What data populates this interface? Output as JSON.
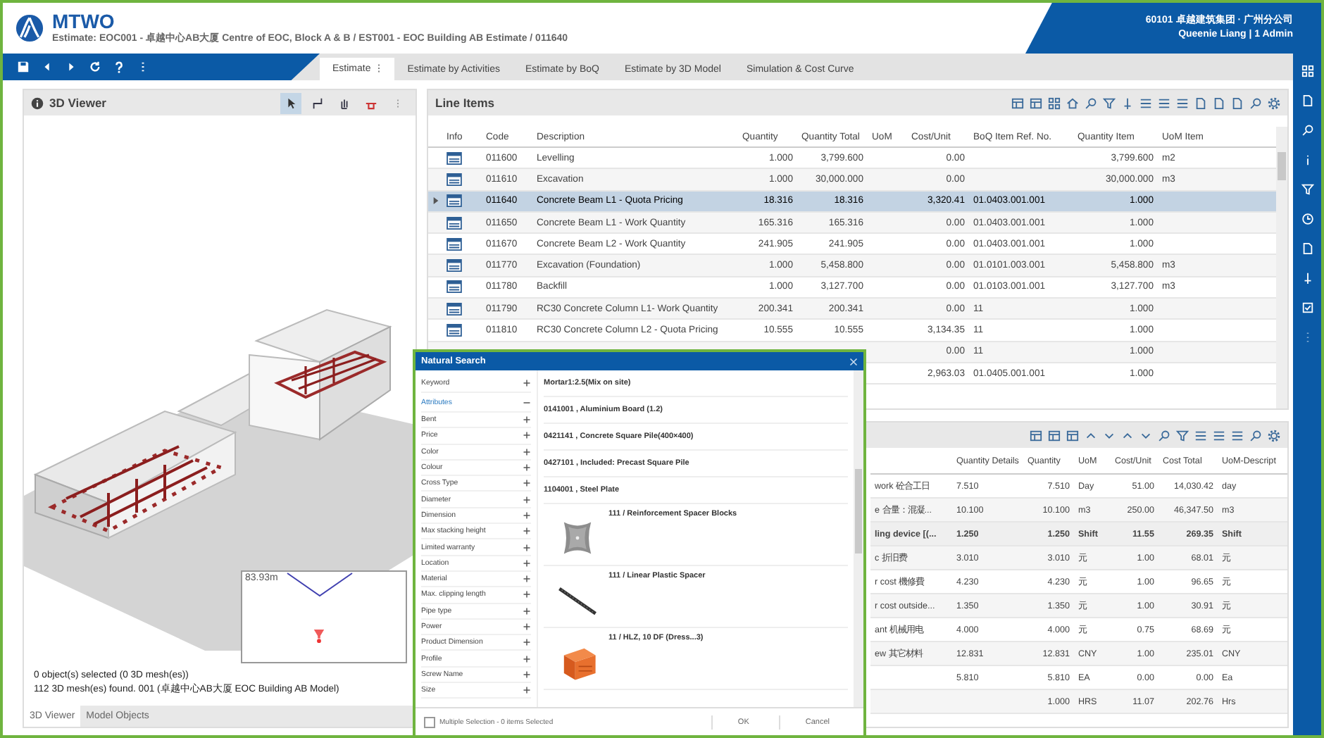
{
  "app": {
    "logo": "MTWO",
    "breadcrumb": "Estimate: EOC001 - 卓越中心AB大厦 Centre of EOC, Block A & B / EST001 - EOC Building AB Estimate / 011640",
    "company": "60101 卓越建筑集团 · 广州分公司",
    "user": "Queenie Liang | 1 Admin"
  },
  "tabs": [
    {
      "label": "Estimate",
      "selected": true
    },
    {
      "label": "Estimate by Activities",
      "selected": false
    },
    {
      "label": "Estimate by BoQ",
      "selected": false
    },
    {
      "label": "Estimate by 3D Model",
      "selected": false
    },
    {
      "label": "Simulation & Cost Curve",
      "selected": false
    }
  ],
  "viewer": {
    "title": "3D Viewer",
    "scale_label": "83.93m",
    "status": [
      "0 object(s) selected (0 3D mesh(es))",
      "112 3D mesh(es) found.   001 (卓越中心AB大厦 EOC Building AB Model)"
    ],
    "tabs": [
      {
        "label": "3D Viewer",
        "selected": true
      },
      {
        "label": "Model Objects",
        "selected": false
      }
    ]
  },
  "line_items": {
    "title": "Line Items",
    "columns": [
      "Info",
      "Code",
      "Description",
      "Quantity",
      "Quantity Total",
      "UoM",
      "Cost/Unit",
      "BoQ Item Ref. No.",
      "Quantity Item",
      "UoM Item"
    ],
    "rows": [
      {
        "selected": false,
        "cells": [
          "",
          "011600",
          "Levelling",
          "1.000",
          "3,799.600",
          null,
          "0.00",
          null,
          "3,799.600",
          "m2"
        ]
      },
      {
        "selected": false,
        "cells": [
          "",
          "011610",
          "Excavation",
          "1.000",
          "30,000.000",
          null,
          "0.00",
          null,
          "30,000.000",
          "m3"
        ]
      },
      {
        "selected": true,
        "cells": [
          "",
          "011640",
          "Concrete Beam L1 - Quota Pricing",
          "18.316",
          "18.316",
          null,
          "3,320.41",
          "01.0403.001.001",
          "1.000",
          null
        ]
      },
      {
        "selected": false,
        "cells": [
          "",
          "011650",
          "Concrete Beam L1 - Work Quantity",
          "165.316",
          "165.316",
          null,
          "0.00",
          "01.0403.001.001",
          "1.000",
          null
        ]
      },
      {
        "selected": false,
        "cells": [
          "",
          "011670",
          "Concrete Beam L2 - Work Quantity",
          "241.905",
          "241.905",
          null,
          "0.00",
          "01.0403.001.001",
          "1.000",
          null
        ]
      },
      {
        "selected": false,
        "cells": [
          "",
          "011770",
          "Excavation (Foundation)",
          "1.000",
          "5,458.800",
          null,
          "0.00",
          "01.0101.003.001",
          "5,458.800",
          "m3"
        ]
      },
      {
        "selected": false,
        "cells": [
          "",
          "011780",
          "Backfill",
          "1.000",
          "3,127.700",
          null,
          "0.00",
          "01.0103.001.001",
          "3,127.700",
          "m3"
        ]
      },
      {
        "selected": false,
        "cells": [
          "",
          "011790",
          "RC30 Concrete Column L1- Work Quantity",
          "200.341",
          "200.341",
          null,
          "0.00",
          "11",
          "1.000",
          null
        ]
      },
      {
        "selected": false,
        "cells": [
          "",
          "011810",
          "RC30 Concrete Column L2 - Quota Pricing",
          "10.555",
          "10.555",
          null,
          "3,134.35",
          "11",
          "1.000",
          null
        ]
      },
      {
        "selected": false,
        "cells": [
          null,
          null,
          null,
          null,
          null,
          null,
          "0.00",
          "11",
          "1.000",
          null
        ]
      },
      {
        "selected": false,
        "cells": [
          null,
          null,
          null,
          null,
          null,
          null,
          "2,963.03",
          "01.0405.001.001",
          "1.000",
          null
        ]
      }
    ]
  },
  "detail_table": {
    "columns": [
      null,
      "Quantity Details",
      "Quantity",
      "UoM",
      "Cost/Unit",
      "Cost Total",
      "UoM-Descript"
    ],
    "rows": [
      {
        "selected": false,
        "cells": [
          "work 砼合工日",
          "7.510",
          "7.510",
          "Day",
          "51.00",
          "14,030.42",
          "day"
        ]
      },
      {
        "selected": false,
        "cells": [
          "e 合量：混凝...",
          "10.100",
          "10.100",
          "m3",
          "250.00",
          "46,347.50",
          "m3"
        ]
      },
      {
        "selected": true,
        "cells": [
          "ling device [(...",
          "1.250",
          "1.250",
          "Shift",
          "11.55",
          "269.35",
          "Shift"
        ]
      },
      {
        "selected": false,
        "cells": [
          "c 折旧费",
          "3.010",
          "3.010",
          "元",
          "1.00",
          "68.01",
          "元"
        ]
      },
      {
        "selected": false,
        "cells": [
          "r cost 機修費",
          "4.230",
          "4.230",
          "元",
          "1.00",
          "96.65",
          "元"
        ]
      },
      {
        "selected": false,
        "cells": [
          "r cost outside...",
          "1.350",
          "1.350",
          "元",
          "1.00",
          "30.91",
          "元"
        ]
      },
      {
        "selected": false,
        "cells": [
          "ant 机械用电",
          "4.000",
          "4.000",
          "元",
          "0.75",
          "68.69",
          "元"
        ]
      },
      {
        "selected": false,
        "cells": [
          "ew 其它材料",
          "12.831",
          "12.831",
          "CNY",
          "1.00",
          "235.01",
          "CNY"
        ]
      },
      {
        "selected": false,
        "cells": [
          null,
          "5.810",
          "5.810",
          "EA",
          "0.00",
          "0.00",
          "Ea"
        ]
      },
      {
        "selected": false,
        "cells": [
          null,
          null,
          "1.000",
          "HRS",
          "11.07",
          "202.76",
          "Hrs"
        ]
      }
    ]
  },
  "natural_search": {
    "title": "Natural Search",
    "groups": [
      {
        "label": "Keyword",
        "expanded": false
      },
      {
        "label": "Attributes",
        "expanded": true,
        "children": [
          {
            "label": "Bent",
            "expanded": false
          },
          {
            "label": "Price",
            "expanded": false
          },
          {
            "label": "Color",
            "expanded": false
          },
          {
            "label": "Colour",
            "expanded": false
          },
          {
            "label": "Cross Type",
            "expanded": false
          },
          {
            "label": "Diameter",
            "expanded": false
          },
          {
            "label": "Dimension",
            "expanded": false
          },
          {
            "label": "Max stacking height",
            "expanded": false
          },
          {
            "label": "Limited warranty",
            "expanded": false
          },
          {
            "label": "Location",
            "expanded": false
          },
          {
            "label": "Material",
            "expanded": false
          },
          {
            "label": "Max. clipping length",
            "expanded": false
          },
          {
            "label": "Pipe type",
            "expanded": false
          },
          {
            "label": "Power",
            "expanded": false
          },
          {
            "label": "Product Dimension",
            "expanded": false
          },
          {
            "label": "Profile",
            "expanded": false
          },
          {
            "label": "Screw Name",
            "expanded": false
          },
          {
            "label": "Size",
            "expanded": false
          }
        ]
      }
    ],
    "results": [
      {
        "kind": "text",
        "label": "Mortar1:2.5(Mix on site)"
      },
      {
        "kind": "text",
        "label": "0141001 , Aluminium Board (1.2)"
      },
      {
        "kind": "text",
        "label": "0421141 , Concrete Square Pile(400×400)"
      },
      {
        "kind": "text",
        "label": "0427101 , Included: Precast Square Pile"
      },
      {
        "kind": "text",
        "label": "1104001 , Steel Plate"
      },
      {
        "kind": "spacer",
        "label": "111 / Reinforcement Spacer Blocks"
      },
      {
        "kind": "rod",
        "label": "111 / Linear Plastic Spacer"
      },
      {
        "kind": "brick",
        "label": "11 / HLZ, 10 DF (Dress...3)"
      }
    ],
    "multiple_selection": {
      "label": "Multiple Selection - 0 items Selected",
      "checked": false
    },
    "buttons": [
      "OK",
      "Cancel"
    ]
  }
}
